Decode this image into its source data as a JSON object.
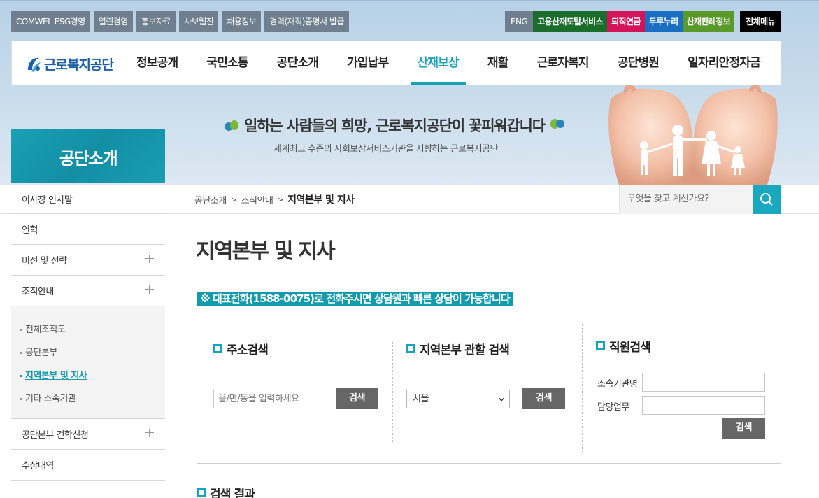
{
  "util_left": [
    "COMWEL ESG경영",
    "열린경영",
    "홍보자료",
    "사보웹진",
    "채용정보",
    "경력(재직)증명서 발급"
  ],
  "util_right": [
    {
      "label": "ENG",
      "color": "#6f7f8f"
    },
    {
      "label": "고용산재토탈서비스",
      "color": "#1a6d2a"
    },
    {
      "label": "퇴직연금",
      "color": "#d4145a"
    },
    {
      "label": "두루누리",
      "color": "#1b6fc2"
    },
    {
      "label": "산재판례정보",
      "color": "#5a9a2a"
    },
    {
      "label": "전체메뉴",
      "color": "#000000"
    }
  ],
  "logo_text": "근로복지공단",
  "gnb": [
    "정보공개",
    "국민소통",
    "공단소개",
    "가입납부",
    "산재보상",
    "재활",
    "근로자복지",
    "공단병원",
    "일자리안정자금"
  ],
  "gnb_active": "산재보상",
  "slogan": "일하는 사람들의 희망, 근로복지공단이 꽃피워갑니다",
  "sub_slogan": "세계최고 수준의 사회보장서비스기관을 지향하는 근로복지공단",
  "section_title": "공단소개",
  "breadcrumb": {
    "level1": "공단소개",
    "level2": "조직안내",
    "current": "지역본부 및 지사"
  },
  "search": {
    "placeholder": "무엇을 찾고 계신가요?"
  },
  "lnb": {
    "items": [
      "이사장 인사말",
      "연혁",
      "비전 및 전략",
      "조직안내"
    ],
    "sub": [
      "전체조직도",
      "공단본부",
      "지역본부 및 지사",
      "기타 소속기관"
    ],
    "bottom": [
      "공단본부 견학신청",
      "수상내역"
    ]
  },
  "page_title": "지역본부 및 지사",
  "notice": "※ 대표전화(1588-0075)로 전화주시면 상담원과 빠른 상담이 가능합니다",
  "address_search": {
    "title": "주소검색",
    "placeholder": "읍/면/동을 입력하세요",
    "button": "검색"
  },
  "region_search": {
    "title": "지역본부 관할 검색",
    "selected": "서울",
    "button": "검색"
  },
  "staff_search": {
    "title": "직원검색",
    "label_org": "소속기관명",
    "label_duty": "담당업무",
    "button": "검색"
  },
  "result_title": "검색 결과",
  "accent_color": "#1aa3b8"
}
